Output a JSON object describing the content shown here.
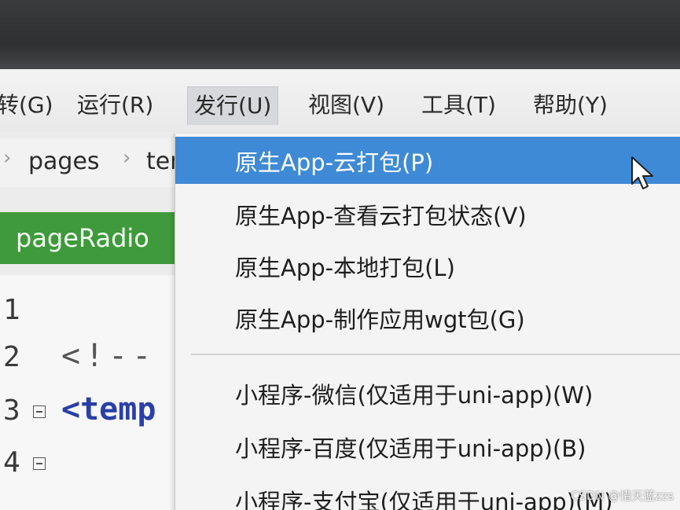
{
  "menubar": {
    "items": [
      "转(G)",
      "运行(R)",
      "发行(U)",
      "视图(V)",
      "工具(T)",
      "帮助(Y)"
    ]
  },
  "breadcrumb": {
    "items": [
      "pages",
      "ter"
    ]
  },
  "tab": {
    "label": "pageRadio"
  },
  "editor": {
    "lines": [
      {
        "number": "1",
        "code": ""
      },
      {
        "number": "2",
        "code": "<!--"
      },
      {
        "number": "3",
        "code": "<temp"
      },
      {
        "number": "4",
        "code": ""
      }
    ]
  },
  "dropdown": {
    "items": [
      "原生App-云打包(P)",
      "原生App-查看云打包状态(V)",
      "原生App-本地打包(L)",
      "原生App-制作应用wgt包(G)",
      "小程序-微信(仅适用于uni-app)(W)",
      "小程序-百度(仅适用于uni-app)(B)",
      "小程序-支付宝(仅适用于uni-app)(M)"
    ]
  },
  "watermark": "CSDN @惜天蓝zzs",
  "colors": {
    "highlight": "#3f8ad6",
    "tab_green": "#3e9a3a",
    "tag_blue": "#2a3fa8"
  }
}
